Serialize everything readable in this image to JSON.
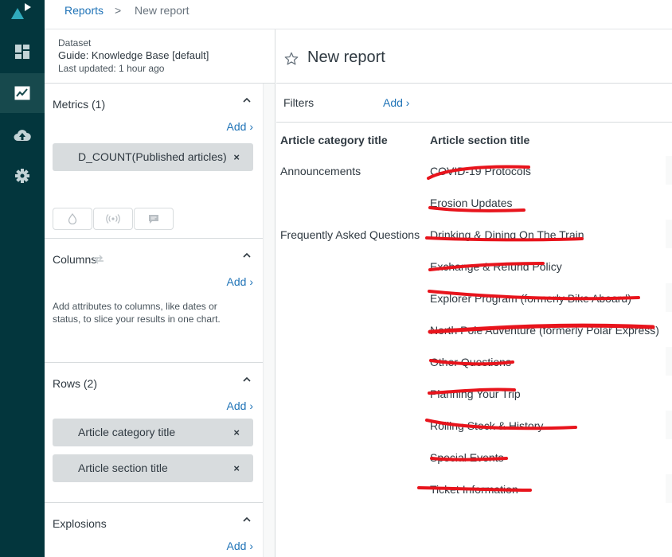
{
  "breadcrumb": {
    "link": "Reports",
    "separator": ">",
    "current": "New report"
  },
  "nav": {
    "icons": [
      "dashboard-icon",
      "reports-icon",
      "cloud-upload-icon",
      "settings-icon"
    ],
    "active": "reports-icon"
  },
  "dataset": {
    "label": "Dataset",
    "name": "Guide: Knowledge Base [default]",
    "updated": "Last updated: 1 hour ago"
  },
  "metrics": {
    "title": "Metrics (1)",
    "add": "Add",
    "items": [
      "D_COUNT(Published articles)"
    ],
    "remove": "×"
  },
  "columns": {
    "title": "Columns",
    "add": "Add",
    "hint": "Add attributes to columns, like dates or status, to slice your results in one chart."
  },
  "rows": {
    "title": "Rows (2)",
    "add": "Add",
    "items": [
      "Article category title",
      "Article section title"
    ],
    "remove": "×"
  },
  "explosions": {
    "title": "Explosions",
    "add": "Add"
  },
  "report": {
    "title": "New report"
  },
  "filters": {
    "label": "Filters",
    "add": "Add"
  },
  "table": {
    "headers": [
      "Article category title",
      "Article section title"
    ],
    "rows": [
      [
        "Announcements",
        "COVID-19 Protocols"
      ],
      [
        "",
        "Erosion Updates"
      ],
      [
        "Frequently Asked Questions",
        "Drinking & Dining On The Train"
      ],
      [
        "",
        "Exchange & Refund Policy"
      ],
      [
        "",
        "Explorer Program (formerly Bike Aboard)"
      ],
      [
        "",
        "North Pole Adventure (formerly Polar Express)"
      ],
      [
        "",
        "Other Questions"
      ],
      [
        "",
        "Planning Your Trip"
      ],
      [
        "",
        "Rolling Stock & History"
      ],
      [
        "",
        "Special Events"
      ],
      [
        "",
        "Ticket Information"
      ]
    ]
  },
  "colors": {
    "nav_bg": "#03363d",
    "nav_active": "#17494d",
    "link": "#1f73b7",
    "pill": "#d8dcde",
    "redaction": "#e8141c"
  }
}
